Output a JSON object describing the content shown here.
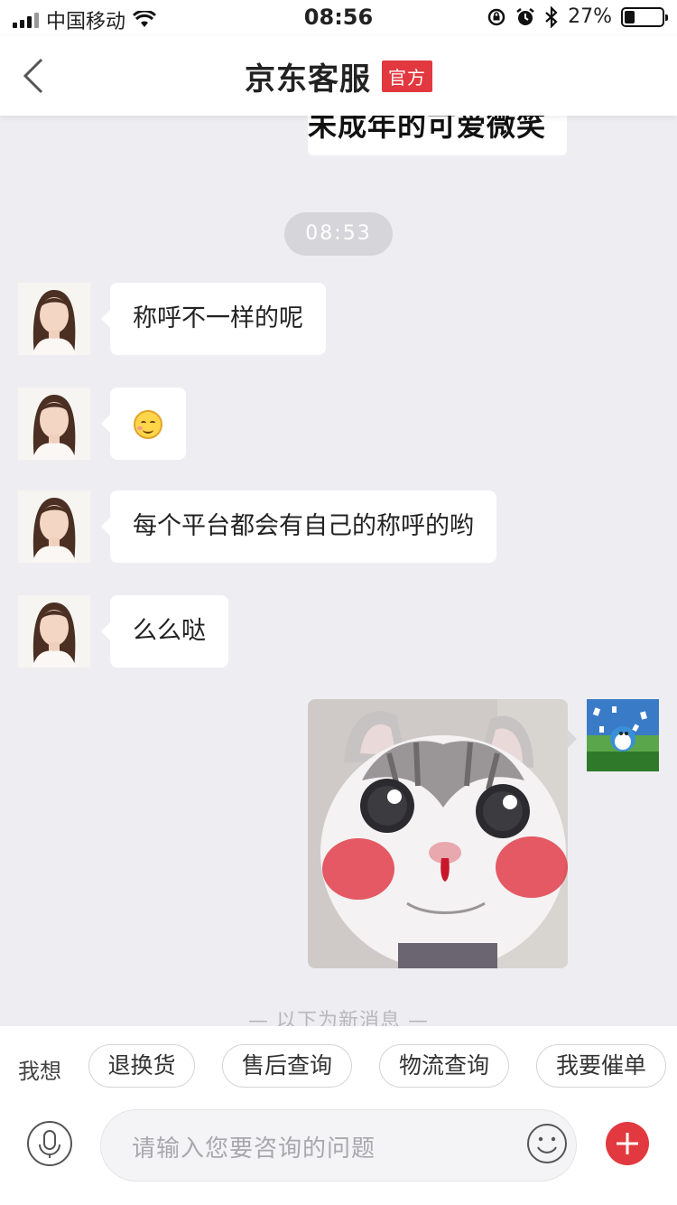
{
  "status_bar": {
    "carrier": "中国移动",
    "time": "08:56",
    "battery_text": "27%",
    "battery_level": 0.27
  },
  "header": {
    "title": "京东客服",
    "badge": "官方"
  },
  "chat": {
    "clipped_text": "未成年的可爱微笑",
    "time_divider": "08:53",
    "messages": [
      {
        "side": "left",
        "text": "称呼不一样的呢"
      },
      {
        "side": "left",
        "text": "",
        "icon": "smile-emoji-icon"
      },
      {
        "side": "left",
        "text": "每个平台都会有自己的称呼的哟"
      },
      {
        "side": "left",
        "text": "么么哒"
      }
    ],
    "new_messages_note": "— 以下为新消息 —"
  },
  "quick_actions": {
    "label": "我想",
    "chips": [
      "退换货",
      "售后查询",
      "物流查询",
      "我要催单"
    ]
  },
  "input": {
    "placeholder": "请输入您要咨询的问题"
  },
  "colors": {
    "accent": "#e2383f",
    "background": "#eeeef2"
  }
}
